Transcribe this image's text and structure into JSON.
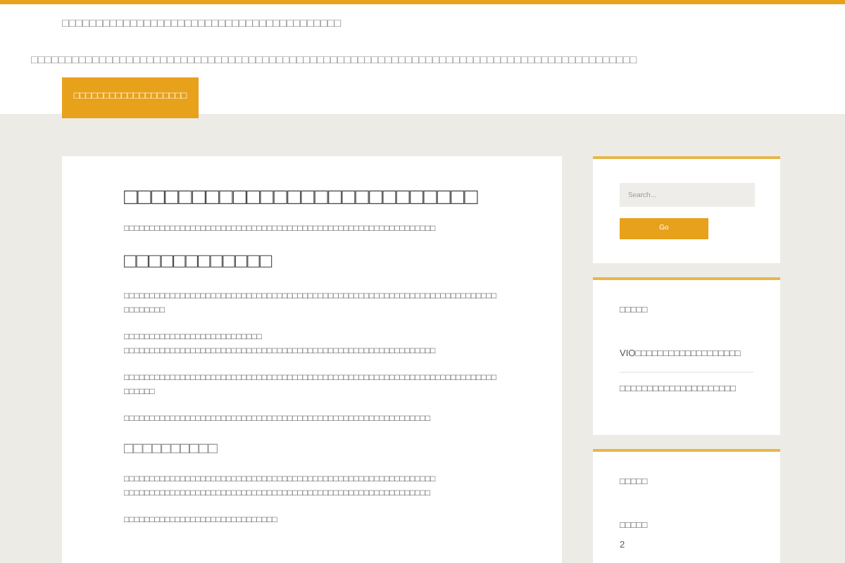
{
  "site": {
    "title": "□□□□□□□□□□□□□□□□□□□□□□□□□□□□□□□□□□□□□□□□□",
    "tagline": "□□□□□□□□□□□□□□□□□□□□□□□□□□□□□□□□□□□□□□□□□□□□□□□□□□□□□□□□□□□□□□□□□□□□□□□□□□□□□□□□□□□□□□□□□",
    "nav": [
      {
        "label": "□□□□□□□□□□□□□□□□□□□",
        "selected": true
      }
    ]
  },
  "article": {
    "blocks": [
      {
        "kind": "h1",
        "text": "□□□□□□□□□□□□□□□□□□□□□□□□□□"
      },
      {
        "kind": "p",
        "text": "□□□□□□□□□□□□□□□□□□□□□□□□□□□□□□□□□□□□□□□□□□□□□□□□□□□□□□□□□□□□□"
      },
      {
        "kind": "h2",
        "text": "□□□□□□□□□□□□"
      },
      {
        "kind": "p",
        "text": "□□□□□□□□□□□□□□□□□□□□□□□□□□□□□□□□□□□□□□□□□□□□□□□□□□□□□□□□□□□□□□□□□□□□□□□□□□□□□□□□□"
      },
      {
        "kind": "p",
        "lines": [
          "□□□□□□□□□□□□□□□□□□□□□□□□□□□",
          "□□□□□□□□□□□□□□□□□□□□□□□□□□□□□□□□□□□□□□□□□□□□□□□□□□□□□□□□□□□□□"
        ]
      },
      {
        "kind": "p",
        "text": "□□□□□□□□□□□□□□□□□□□□□□□□□□□□□□□□□□□□□□□□□□□□□□□□□□□□□□□□□□□□□□□□□□□□□□□□□□□□□□□"
      },
      {
        "kind": "p",
        "text": "□□□□□□□□□□□□□□□□□□□□□□□□□□□□□□□□□□□□□□□□□□□□□□□□□□□□□□□□□□□□"
      },
      {
        "kind": "h3",
        "text": "□□□□□□□□□□"
      },
      {
        "kind": "p",
        "lines": [
          "□□□□□□□□□□□□□□□□□□□□□□□□□□□□□□□□□□□□□□□□□□□□□□□□□□□□□□□□□□□□□",
          "□□□□□□□□□□□□□□□□□□□□□□□□□□□□□□□□□□□□□□□□□□□□□□□□□□□□□□□□□□□□"
        ]
      },
      {
        "kind": "p",
        "text": "□□□□□□□□□□□□□□□□□□□□□□□□□□□□□□"
      }
    ]
  },
  "sidebar": {
    "search": {
      "placeholder": "Search...",
      "button": "Go"
    },
    "widgets": [
      {
        "title": "□□□□□",
        "items": [
          "VIO□□□□□□□□□□□□□□□□□□□",
          "□□□□□□□□□□□□□□□□□□□□□"
        ]
      },
      {
        "title": "□□□□□",
        "items": [
          "□□□□□"
        ],
        "note": "2"
      }
    ]
  }
}
